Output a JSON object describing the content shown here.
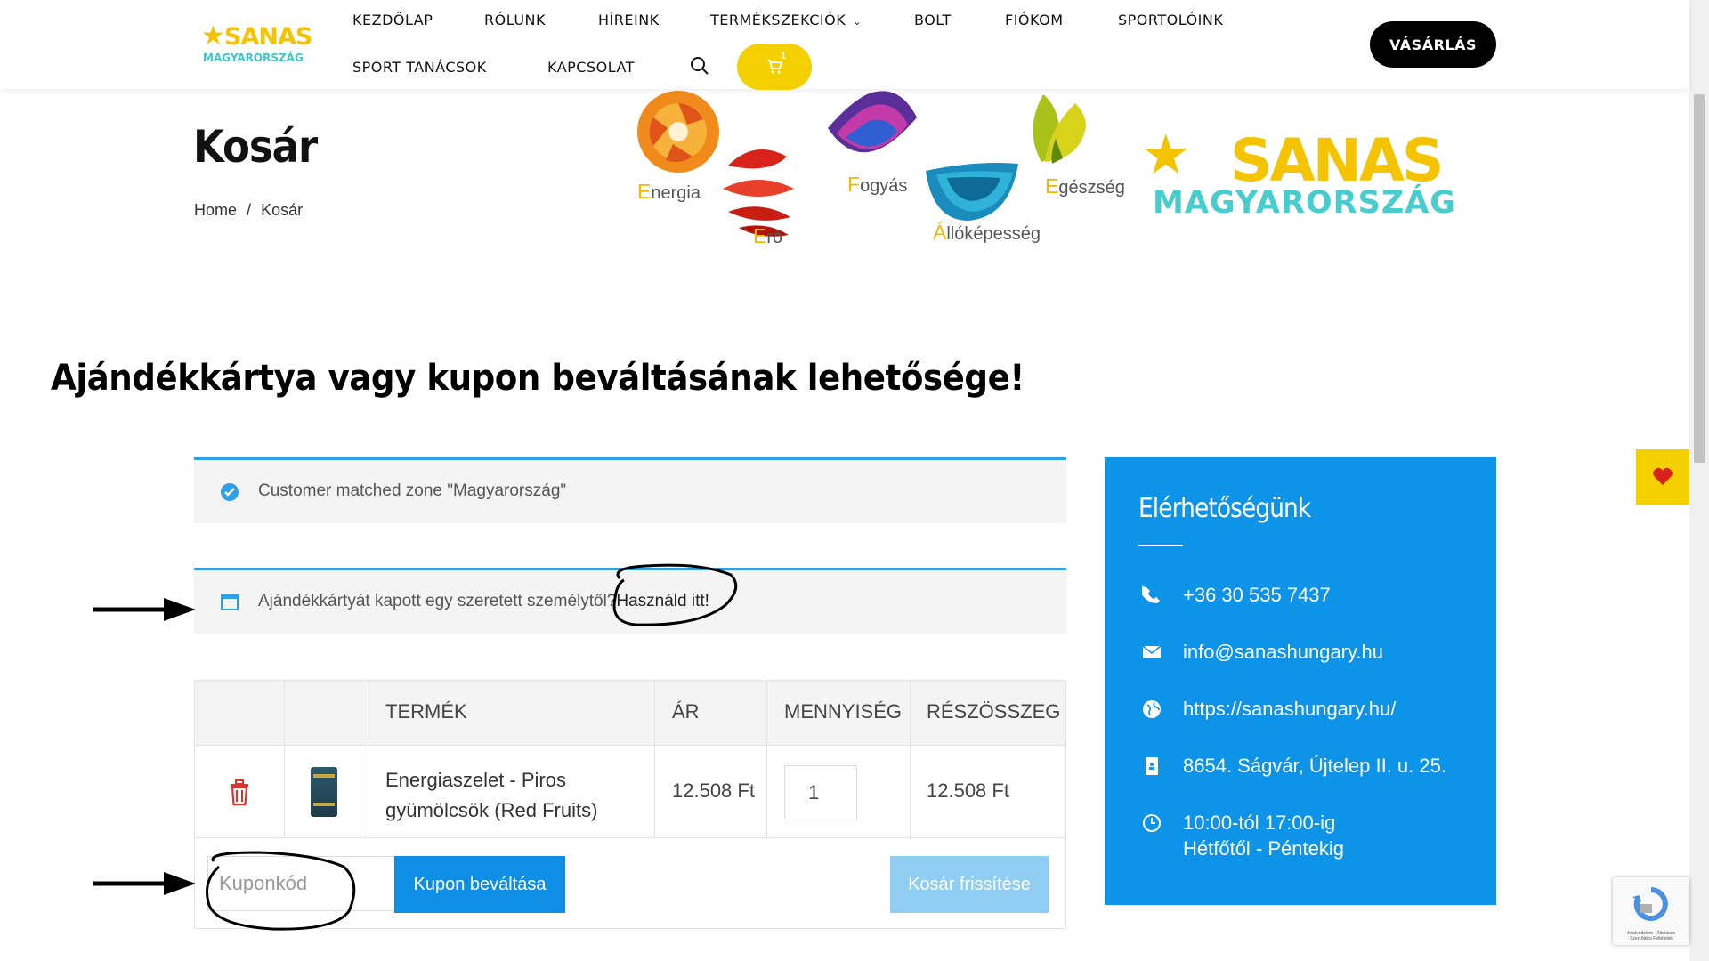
{
  "header": {
    "logo": {
      "line1": "SANAS",
      "line2": "MAGYARORSZÁG"
    },
    "nav": [
      {
        "label": "KEZDŐLAP"
      },
      {
        "label": "RÓLUNK"
      },
      {
        "label": "HÍREINK"
      },
      {
        "label": "TERMÉKSZEKCIÓK"
      },
      {
        "label": "BOLT"
      },
      {
        "label": "FIÓKOM"
      },
      {
        "label": "SPORTOLÓINK"
      },
      {
        "label": "SPORT TANÁCSOK"
      },
      {
        "label": "KAPCSOLAT"
      }
    ],
    "cart_count": "1",
    "buy_label": "VÁSÁRLÁS",
    "icons": {
      "search": "search-icon",
      "cart": "cart-icon"
    }
  },
  "page": {
    "title": "Kosár",
    "breadcrumb": {
      "home": "Home",
      "separator": "/",
      "current": "Kosár"
    }
  },
  "banner": {
    "labels": [
      {
        "first": "E",
        "rest": "nergia"
      },
      {
        "first": "E",
        "rest": "rő"
      },
      {
        "first": "F",
        "rest": "ogyás"
      },
      {
        "first": "Á",
        "rest": "llóképesség"
      },
      {
        "first": "E",
        "rest": "gészség"
      }
    ],
    "logo": {
      "line1": "SANAS",
      "line2": "MAGYARORSZÁG"
    }
  },
  "promo_heading": "Ajándékkártya vagy kupon beváltásának lehetősége!",
  "notices": {
    "zone": "Customer matched zone \"Magyarország\"",
    "gift_prefix": "Ajándékkártyát kapott egy szeretett személytől?",
    "gift_link": "Használd itt!"
  },
  "cart": {
    "headers": {
      "product": "TERMÉK",
      "price": "ÁR",
      "quantity": "MENNYISÉG",
      "subtotal": "RÉSZÖSSZEG"
    },
    "items": [
      {
        "name_line1": "Energiaszelet - Piros",
        "name_line2": "gyümölcsök (Red Fruits)",
        "price": "12.508 Ft",
        "quantity": "1",
        "subtotal": "12.508 Ft"
      }
    ],
    "coupon_placeholder": "Kuponkód",
    "apply_coupon_label": "Kupon beváltása",
    "update_cart_label": "Kosár frissítése"
  },
  "contact": {
    "title": "Elérhetőségünk",
    "items": [
      {
        "icon": "phone-icon",
        "text": "+36 30 535 7437"
      },
      {
        "icon": "mail-icon",
        "text": "info@sanashungary.hu"
      },
      {
        "icon": "globe-icon",
        "text": "https://sanashungary.hu/"
      },
      {
        "icon": "address-icon",
        "text": "8654. Ságvár, Újtelep II. u. 25."
      },
      {
        "icon": "clock-icon",
        "text": "10:00-tól 17:00-ig",
        "text2": "Hétfőtől - Péntekig"
      }
    ]
  },
  "recaptcha_text": "Adatvédelem - Általános Szerződési Feltételek",
  "colors": {
    "accent_blue": "#0d93e8",
    "brand_yellow": "#f5c400",
    "teal": "#47cdcd"
  }
}
